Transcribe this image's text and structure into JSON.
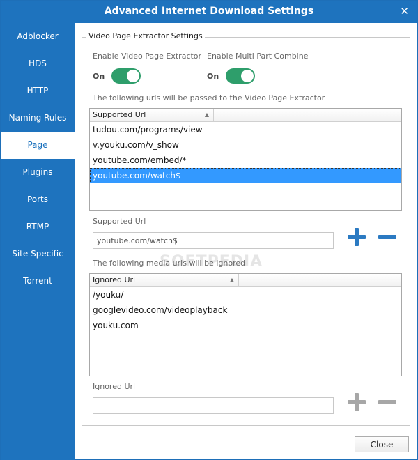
{
  "window": {
    "title": "Advanced Internet Download Settings",
    "close_glyph": "✕"
  },
  "sidebar": {
    "items": [
      {
        "label": "Adblocker"
      },
      {
        "label": "HDS"
      },
      {
        "label": "HTTP"
      },
      {
        "label": "Naming Rules"
      },
      {
        "label": "Page",
        "active": true
      },
      {
        "label": "Plugins"
      },
      {
        "label": "Ports"
      },
      {
        "label": "RTMP"
      },
      {
        "label": "Site Specific"
      },
      {
        "label": "Torrent"
      }
    ]
  },
  "group": {
    "title": "Video Page Extractor Settings",
    "enable_extractor": {
      "label": "Enable Video Page Extractor",
      "state": "On"
    },
    "enable_multipart": {
      "label": "Enable Multi Part Combine",
      "state": "On"
    },
    "supported_list": {
      "caption": "The following urls will be passed to the Video Page Extractor",
      "column": "Supported Url",
      "rows": [
        "tudou.com/programs/view",
        "v.youku.com/v_show",
        "youtube.com/embed/*",
        "youtube.com/watch$"
      ],
      "selected_index": 3
    },
    "supported_input": {
      "label": "Supported Url",
      "value": "youtube.com/watch$"
    },
    "ignored_list": {
      "caption": "The following media urls will be ignored",
      "column": "Ignored Url",
      "rows": [
        "/youku/",
        "googlevideo.com/videoplayback",
        "youku.com"
      ]
    },
    "ignored_input": {
      "label": "Ignored Url",
      "value": ""
    }
  },
  "watermark": "SOFTPEDIA",
  "footer": {
    "close_label": "Close"
  },
  "colors": {
    "accent": "#1e73be",
    "toggle_on": "#2e9e6b",
    "selection": "#3399ff"
  }
}
